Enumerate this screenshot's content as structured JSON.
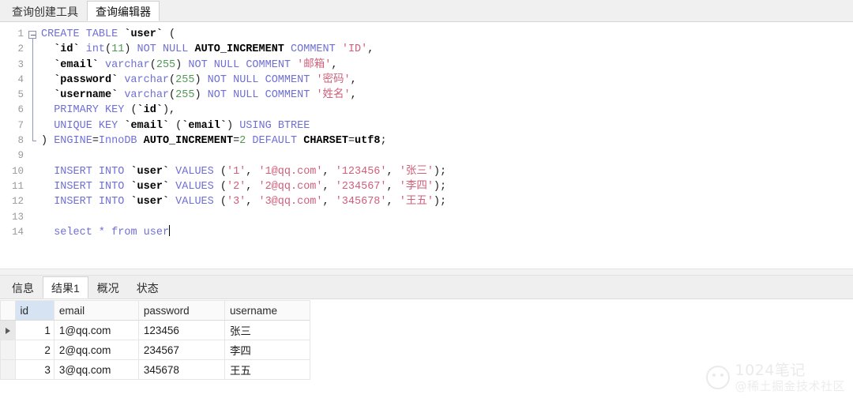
{
  "top_tabs": [
    {
      "label": "查询创建工具",
      "active": false
    },
    {
      "label": "查询编辑器",
      "active": true
    }
  ],
  "editor": {
    "caret_line": 14,
    "lines": [
      {
        "n": "1",
        "fold": "start",
        "tokens": [
          {
            "t": "CREATE",
            "c": "kw"
          },
          {
            "t": " ",
            "c": "pun"
          },
          {
            "t": "TABLE",
            "c": "kw"
          },
          {
            "t": " ",
            "c": "pun"
          },
          {
            "t": "`user`",
            "c": "idn"
          },
          {
            "t": " (",
            "c": "pun"
          }
        ]
      },
      {
        "n": "2",
        "fold": "bar",
        "tokens": [
          {
            "t": "  ",
            "c": "pun"
          },
          {
            "t": "`id`",
            "c": "idn"
          },
          {
            "t": " ",
            "c": "pun"
          },
          {
            "t": "int",
            "c": "kw"
          },
          {
            "t": "(",
            "c": "pun"
          },
          {
            "t": "11",
            "c": "num"
          },
          {
            "t": ") ",
            "c": "pun"
          },
          {
            "t": "NOT",
            "c": "kw"
          },
          {
            "t": " ",
            "c": "pun"
          },
          {
            "t": "NULL",
            "c": "kw"
          },
          {
            "t": " ",
            "c": "pun"
          },
          {
            "t": "AUTO_INCREMENT",
            "c": "kwb"
          },
          {
            "t": " ",
            "c": "pun"
          },
          {
            "t": "COMMENT",
            "c": "kw"
          },
          {
            "t": " ",
            "c": "pun"
          },
          {
            "t": "'ID'",
            "c": "str"
          },
          {
            "t": ",",
            "c": "pun"
          }
        ]
      },
      {
        "n": "3",
        "fold": "bar",
        "tokens": [
          {
            "t": "  ",
            "c": "pun"
          },
          {
            "t": "`email`",
            "c": "idn"
          },
          {
            "t": " ",
            "c": "pun"
          },
          {
            "t": "varchar",
            "c": "kw"
          },
          {
            "t": "(",
            "c": "pun"
          },
          {
            "t": "255",
            "c": "num"
          },
          {
            "t": ") ",
            "c": "pun"
          },
          {
            "t": "NOT",
            "c": "kw"
          },
          {
            "t": " ",
            "c": "pun"
          },
          {
            "t": "NULL",
            "c": "kw"
          },
          {
            "t": " ",
            "c": "pun"
          },
          {
            "t": "COMMENT",
            "c": "kw"
          },
          {
            "t": " ",
            "c": "pun"
          },
          {
            "t": "'邮箱'",
            "c": "str"
          },
          {
            "t": ",",
            "c": "pun"
          }
        ]
      },
      {
        "n": "4",
        "fold": "bar",
        "tokens": [
          {
            "t": "  ",
            "c": "pun"
          },
          {
            "t": "`password`",
            "c": "idn"
          },
          {
            "t": " ",
            "c": "pun"
          },
          {
            "t": "varchar",
            "c": "kw"
          },
          {
            "t": "(",
            "c": "pun"
          },
          {
            "t": "255",
            "c": "num"
          },
          {
            "t": ") ",
            "c": "pun"
          },
          {
            "t": "NOT",
            "c": "kw"
          },
          {
            "t": " ",
            "c": "pun"
          },
          {
            "t": "NULL",
            "c": "kw"
          },
          {
            "t": " ",
            "c": "pun"
          },
          {
            "t": "COMMENT",
            "c": "kw"
          },
          {
            "t": " ",
            "c": "pun"
          },
          {
            "t": "'密码'",
            "c": "str"
          },
          {
            "t": ",",
            "c": "pun"
          }
        ]
      },
      {
        "n": "5",
        "fold": "bar",
        "tokens": [
          {
            "t": "  ",
            "c": "pun"
          },
          {
            "t": "`username`",
            "c": "idn"
          },
          {
            "t": " ",
            "c": "pun"
          },
          {
            "t": "varchar",
            "c": "kw"
          },
          {
            "t": "(",
            "c": "pun"
          },
          {
            "t": "255",
            "c": "num"
          },
          {
            "t": ") ",
            "c": "pun"
          },
          {
            "t": "NOT",
            "c": "kw"
          },
          {
            "t": " ",
            "c": "pun"
          },
          {
            "t": "NULL",
            "c": "kw"
          },
          {
            "t": " ",
            "c": "pun"
          },
          {
            "t": "COMMENT",
            "c": "kw"
          },
          {
            "t": " ",
            "c": "pun"
          },
          {
            "t": "'姓名'",
            "c": "str"
          },
          {
            "t": ",",
            "c": "pun"
          }
        ]
      },
      {
        "n": "6",
        "fold": "bar",
        "tokens": [
          {
            "t": "  ",
            "c": "pun"
          },
          {
            "t": "PRIMARY",
            "c": "kw"
          },
          {
            "t": " ",
            "c": "pun"
          },
          {
            "t": "KEY",
            "c": "kw"
          },
          {
            "t": " (",
            "c": "pun"
          },
          {
            "t": "`id`",
            "c": "idn"
          },
          {
            "t": "),",
            "c": "pun"
          }
        ]
      },
      {
        "n": "7",
        "fold": "bar",
        "tokens": [
          {
            "t": "  ",
            "c": "pun"
          },
          {
            "t": "UNIQUE",
            "c": "kw"
          },
          {
            "t": " ",
            "c": "pun"
          },
          {
            "t": "KEY",
            "c": "kw"
          },
          {
            "t": " ",
            "c": "pun"
          },
          {
            "t": "`email`",
            "c": "idn"
          },
          {
            "t": " (",
            "c": "pun"
          },
          {
            "t": "`email`",
            "c": "idn"
          },
          {
            "t": ") ",
            "c": "pun"
          },
          {
            "t": "USING",
            "c": "kw"
          },
          {
            "t": " ",
            "c": "pun"
          },
          {
            "t": "BTREE",
            "c": "kw"
          }
        ]
      },
      {
        "n": "8",
        "fold": "end",
        "tokens": [
          {
            "t": ") ",
            "c": "pun"
          },
          {
            "t": "ENGINE",
            "c": "kw"
          },
          {
            "t": "=",
            "c": "pun"
          },
          {
            "t": "InnoDB",
            "c": "kw"
          },
          {
            "t": " ",
            "c": "pun"
          },
          {
            "t": "AUTO_INCREMENT",
            "c": "kwb"
          },
          {
            "t": "=",
            "c": "pun"
          },
          {
            "t": "2",
            "c": "num"
          },
          {
            "t": " ",
            "c": "pun"
          },
          {
            "t": "DEFAULT",
            "c": "kw"
          },
          {
            "t": " ",
            "c": "pun"
          },
          {
            "t": "CHARSET",
            "c": "kwb"
          },
          {
            "t": "=",
            "c": "pun"
          },
          {
            "t": "utf8",
            "c": "kwb"
          },
          {
            "t": ";",
            "c": "pun"
          }
        ]
      },
      {
        "n": "9",
        "fold": "none",
        "tokens": []
      },
      {
        "n": "10",
        "fold": "none",
        "tokens": [
          {
            "t": "  ",
            "c": "pun"
          },
          {
            "t": "INSERT",
            "c": "kw"
          },
          {
            "t": " ",
            "c": "pun"
          },
          {
            "t": "INTO",
            "c": "kw"
          },
          {
            "t": " ",
            "c": "pun"
          },
          {
            "t": "`user`",
            "c": "idn"
          },
          {
            "t": " ",
            "c": "pun"
          },
          {
            "t": "VALUES",
            "c": "kw"
          },
          {
            "t": " (",
            "c": "pun"
          },
          {
            "t": "'1'",
            "c": "str"
          },
          {
            "t": ", ",
            "c": "pun"
          },
          {
            "t": "'1@qq.com'",
            "c": "str"
          },
          {
            "t": ", ",
            "c": "pun"
          },
          {
            "t": "'123456'",
            "c": "str"
          },
          {
            "t": ", ",
            "c": "pun"
          },
          {
            "t": "'张三'",
            "c": "str"
          },
          {
            "t": ");",
            "c": "pun"
          }
        ]
      },
      {
        "n": "11",
        "fold": "none",
        "tokens": [
          {
            "t": "  ",
            "c": "pun"
          },
          {
            "t": "INSERT",
            "c": "kw"
          },
          {
            "t": " ",
            "c": "pun"
          },
          {
            "t": "INTO",
            "c": "kw"
          },
          {
            "t": " ",
            "c": "pun"
          },
          {
            "t": "`user`",
            "c": "idn"
          },
          {
            "t": " ",
            "c": "pun"
          },
          {
            "t": "VALUES",
            "c": "kw"
          },
          {
            "t": " (",
            "c": "pun"
          },
          {
            "t": "'2'",
            "c": "str"
          },
          {
            "t": ", ",
            "c": "pun"
          },
          {
            "t": "'2@qq.com'",
            "c": "str"
          },
          {
            "t": ", ",
            "c": "pun"
          },
          {
            "t": "'234567'",
            "c": "str"
          },
          {
            "t": ", ",
            "c": "pun"
          },
          {
            "t": "'李四'",
            "c": "str"
          },
          {
            "t": ");",
            "c": "pun"
          }
        ]
      },
      {
        "n": "12",
        "fold": "none",
        "tokens": [
          {
            "t": "  ",
            "c": "pun"
          },
          {
            "t": "INSERT",
            "c": "kw"
          },
          {
            "t": " ",
            "c": "pun"
          },
          {
            "t": "INTO",
            "c": "kw"
          },
          {
            "t": " ",
            "c": "pun"
          },
          {
            "t": "`user`",
            "c": "idn"
          },
          {
            "t": " ",
            "c": "pun"
          },
          {
            "t": "VALUES",
            "c": "kw"
          },
          {
            "t": " (",
            "c": "pun"
          },
          {
            "t": "'3'",
            "c": "str"
          },
          {
            "t": ", ",
            "c": "pun"
          },
          {
            "t": "'3@qq.com'",
            "c": "str"
          },
          {
            "t": ", ",
            "c": "pun"
          },
          {
            "t": "'345678'",
            "c": "str"
          },
          {
            "t": ", ",
            "c": "pun"
          },
          {
            "t": "'王五'",
            "c": "str"
          },
          {
            "t": ");",
            "c": "pun"
          }
        ]
      },
      {
        "n": "13",
        "fold": "none",
        "tokens": []
      },
      {
        "n": "14",
        "fold": "none",
        "tokens": [
          {
            "t": "  ",
            "c": "pun"
          },
          {
            "t": "select",
            "c": "kw"
          },
          {
            "t": " ",
            "c": "pun"
          },
          {
            "t": "*",
            "c": "kw"
          },
          {
            "t": " ",
            "c": "pun"
          },
          {
            "t": "from",
            "c": "kw"
          },
          {
            "t": " ",
            "c": "pun"
          },
          {
            "t": "user",
            "c": "kw"
          }
        ]
      }
    ]
  },
  "bottom_tabs": [
    {
      "label": "信息",
      "active": false
    },
    {
      "label": "结果1",
      "active": true
    },
    {
      "label": "概况",
      "active": false
    },
    {
      "label": "状态",
      "active": false
    }
  ],
  "result_grid": {
    "selected_column": "id",
    "current_row": 1,
    "columns": [
      "id",
      "email",
      "password",
      "username"
    ],
    "rows": [
      {
        "id": "1",
        "email": "1@qq.com",
        "password": "123456",
        "username": "张三"
      },
      {
        "id": "2",
        "email": "2@qq.com",
        "password": "234567",
        "username": "李四"
      },
      {
        "id": "3",
        "email": "3@qq.com",
        "password": "345678",
        "username": "王五"
      }
    ]
  },
  "watermark": {
    "line1": "1024笔记",
    "line2": "@稀土掘金技术社区"
  }
}
